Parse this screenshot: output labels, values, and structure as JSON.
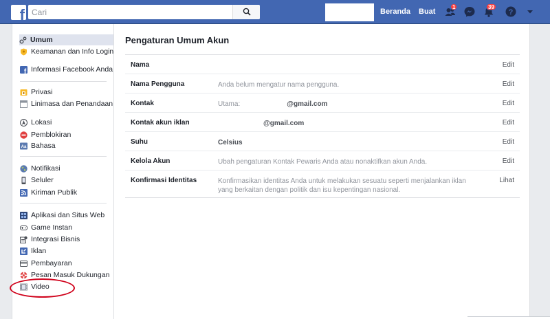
{
  "header": {
    "logo": "f",
    "search_placeholder": "Cari",
    "home_label": "Beranda",
    "create_label": "Buat",
    "friend_requests_count": "1",
    "notifications_count": "39",
    "icons": [
      "facebook-logo",
      "search-icon",
      "friends-icon",
      "messenger-icon",
      "bell-icon",
      "help-icon",
      "caret-down-icon"
    ],
    "color": "#4267b2"
  },
  "sidebar": {
    "group1": [
      {
        "label": "Umum",
        "icon": "gear-icon",
        "active": true
      },
      {
        "label": "Keamanan dan Info Login",
        "icon": "shield-icon"
      },
      {
        "label": "Informasi Facebook Anda",
        "icon": "facebook-icon"
      }
    ],
    "group2": [
      {
        "label": "Privasi",
        "icon": "lock-icon"
      },
      {
        "label": "Linimasa dan Penandaan",
        "icon": "timeline-icon"
      },
      {
        "label": "Lokasi",
        "icon": "location-icon"
      },
      {
        "label": "Pemblokiran",
        "icon": "block-icon"
      },
      {
        "label": "Bahasa",
        "icon": "language-icon"
      }
    ],
    "group3": [
      {
        "label": "Notifikasi",
        "icon": "globe-icon"
      },
      {
        "label": "Seluler",
        "icon": "mobile-icon"
      },
      {
        "label": "Kiriman Publik",
        "icon": "rss-icon"
      }
    ],
    "group4": [
      {
        "label": "Aplikasi dan Situs Web",
        "icon": "apps-icon"
      },
      {
        "label": "Game Instan",
        "icon": "gamepad-icon"
      },
      {
        "label": "Integrasi Bisnis",
        "icon": "business-icon"
      },
      {
        "label": "Iklan",
        "icon": "ads-icon"
      },
      {
        "label": "Pembayaran",
        "icon": "card-icon"
      },
      {
        "label": "Pesan Masuk Dukungan",
        "icon": "lifebuoy-icon"
      },
      {
        "label": "Video",
        "icon": "film-icon"
      }
    ]
  },
  "main": {
    "title": "Pengaturan Umum Akun",
    "rows": [
      {
        "label": "Nama",
        "value": "",
        "action": "Edit"
      },
      {
        "label": "Nama Pengguna",
        "value": "Anda belum mengatur nama pengguna.",
        "action": "Edit"
      },
      {
        "label": "Kontak",
        "prefix": "Utama:",
        "value": "@gmail.com",
        "action": "Edit"
      },
      {
        "label": "Kontak akun iklan",
        "value": "@gmail.com",
        "action": "Edit"
      },
      {
        "label": "Suhu",
        "value": "Celsius",
        "action": "Edit"
      },
      {
        "label": "Kelola Akun",
        "value": "Ubah pengaturan Kontak Pewaris Anda atau nonaktifkan akun Anda.",
        "action": "Edit"
      },
      {
        "label": "Konfirmasi Identitas",
        "value": "Konfirmasikan identitas Anda untuk melakukan sesuatu seperti menjalankan iklan yang berkaitan dengan politik dan isu kepentingan nasional.",
        "action": "Lihat"
      }
    ]
  },
  "annotation_color": "#d0021b"
}
